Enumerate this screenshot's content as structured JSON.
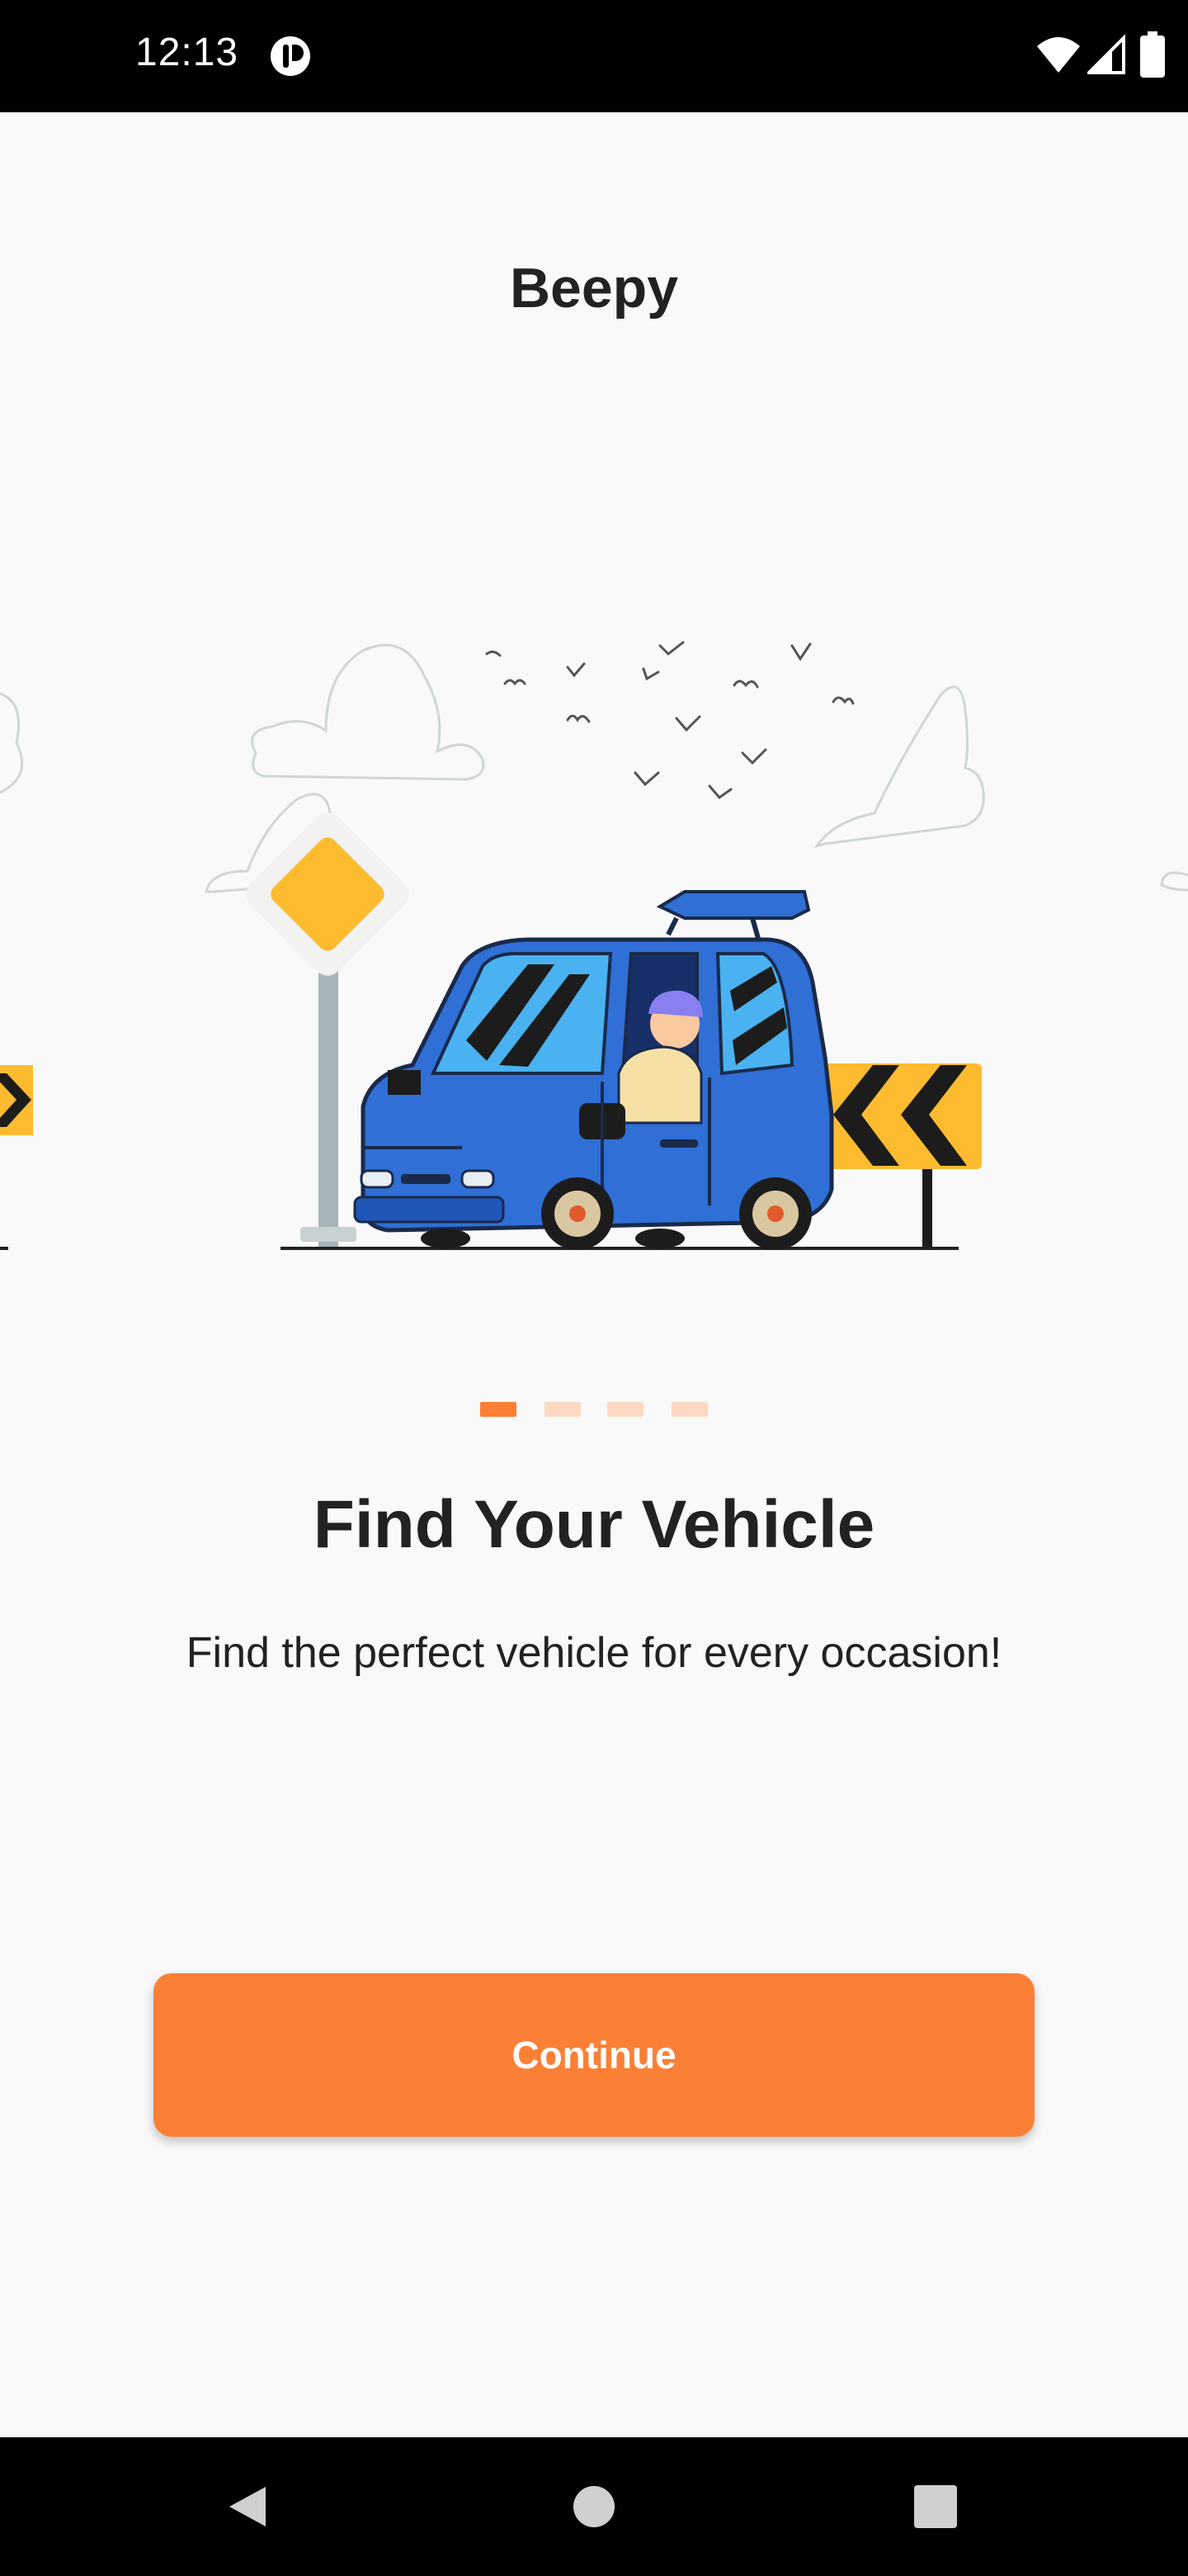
{
  "status_bar": {
    "time": "12:13",
    "icons": [
      "app-notification-icon",
      "wifi-icon",
      "signal-icon",
      "battery-icon"
    ]
  },
  "header": {
    "title": "Beepy"
  },
  "onboarding": {
    "page_count": 4,
    "active_page": 1,
    "headline": "Find Your Vehicle",
    "subtitle": "Find the perfect vehicle for every occasion!",
    "continue_label": "Continue"
  },
  "colors": {
    "accent": "#fb8035",
    "dot_inactive": "#fcd9c3",
    "car_blue": "#2f6fd6",
    "sign_yellow": "#fdbb30"
  },
  "nav_bar": {
    "icons": [
      "back-icon",
      "home-icon",
      "recents-icon"
    ]
  }
}
